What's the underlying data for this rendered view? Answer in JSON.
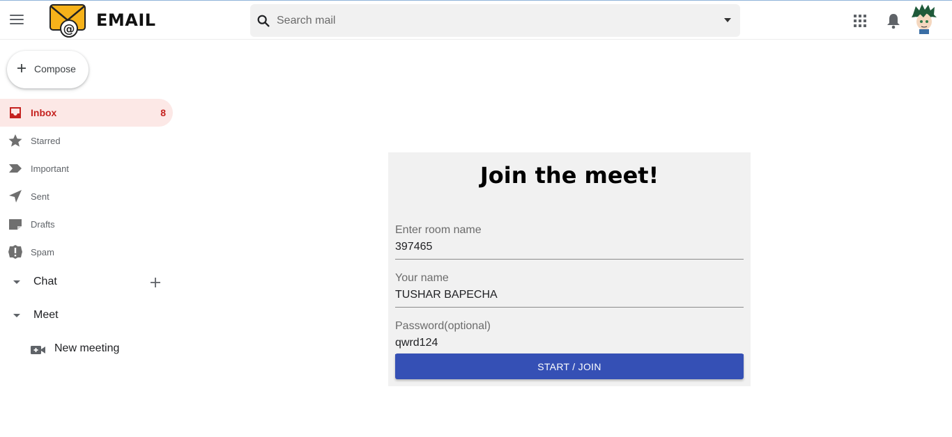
{
  "app": {
    "title": "EMAIL"
  },
  "search": {
    "placeholder": "Search mail"
  },
  "compose": {
    "label": "Compose"
  },
  "nav": {
    "items": [
      {
        "label": "Inbox",
        "count": "8"
      },
      {
        "label": "Starred"
      },
      {
        "label": "Important"
      },
      {
        "label": "Sent"
      },
      {
        "label": "Drafts"
      },
      {
        "label": "Spam"
      }
    ]
  },
  "sections": {
    "chat": {
      "label": "Chat"
    },
    "meet": {
      "label": "Meet",
      "new_meeting": "New meeting"
    }
  },
  "meet_form": {
    "title": "Join the meet!",
    "room": {
      "label": "Enter room name",
      "value": "397465"
    },
    "name": {
      "label": "Your name",
      "value": "TUSHAR BAPECHA"
    },
    "password": {
      "label": "Password(optional)",
      "value": "qwrd124"
    },
    "button": "START / JOIN"
  },
  "colors": {
    "accent": "#3550b5",
    "inbox_active_bg": "#fce8e6",
    "inbox_active_text": "#c5221f",
    "logo": "#f6b21a"
  },
  "icons": [
    "menu-icon",
    "email-logo-icon",
    "search-icon",
    "dropdown-icon",
    "apps-icon",
    "bell-icon",
    "avatar",
    "plus-icon",
    "inbox-icon",
    "star-icon",
    "label-icon",
    "send-icon",
    "drafts-icon",
    "spam-icon",
    "video-plus-icon"
  ]
}
